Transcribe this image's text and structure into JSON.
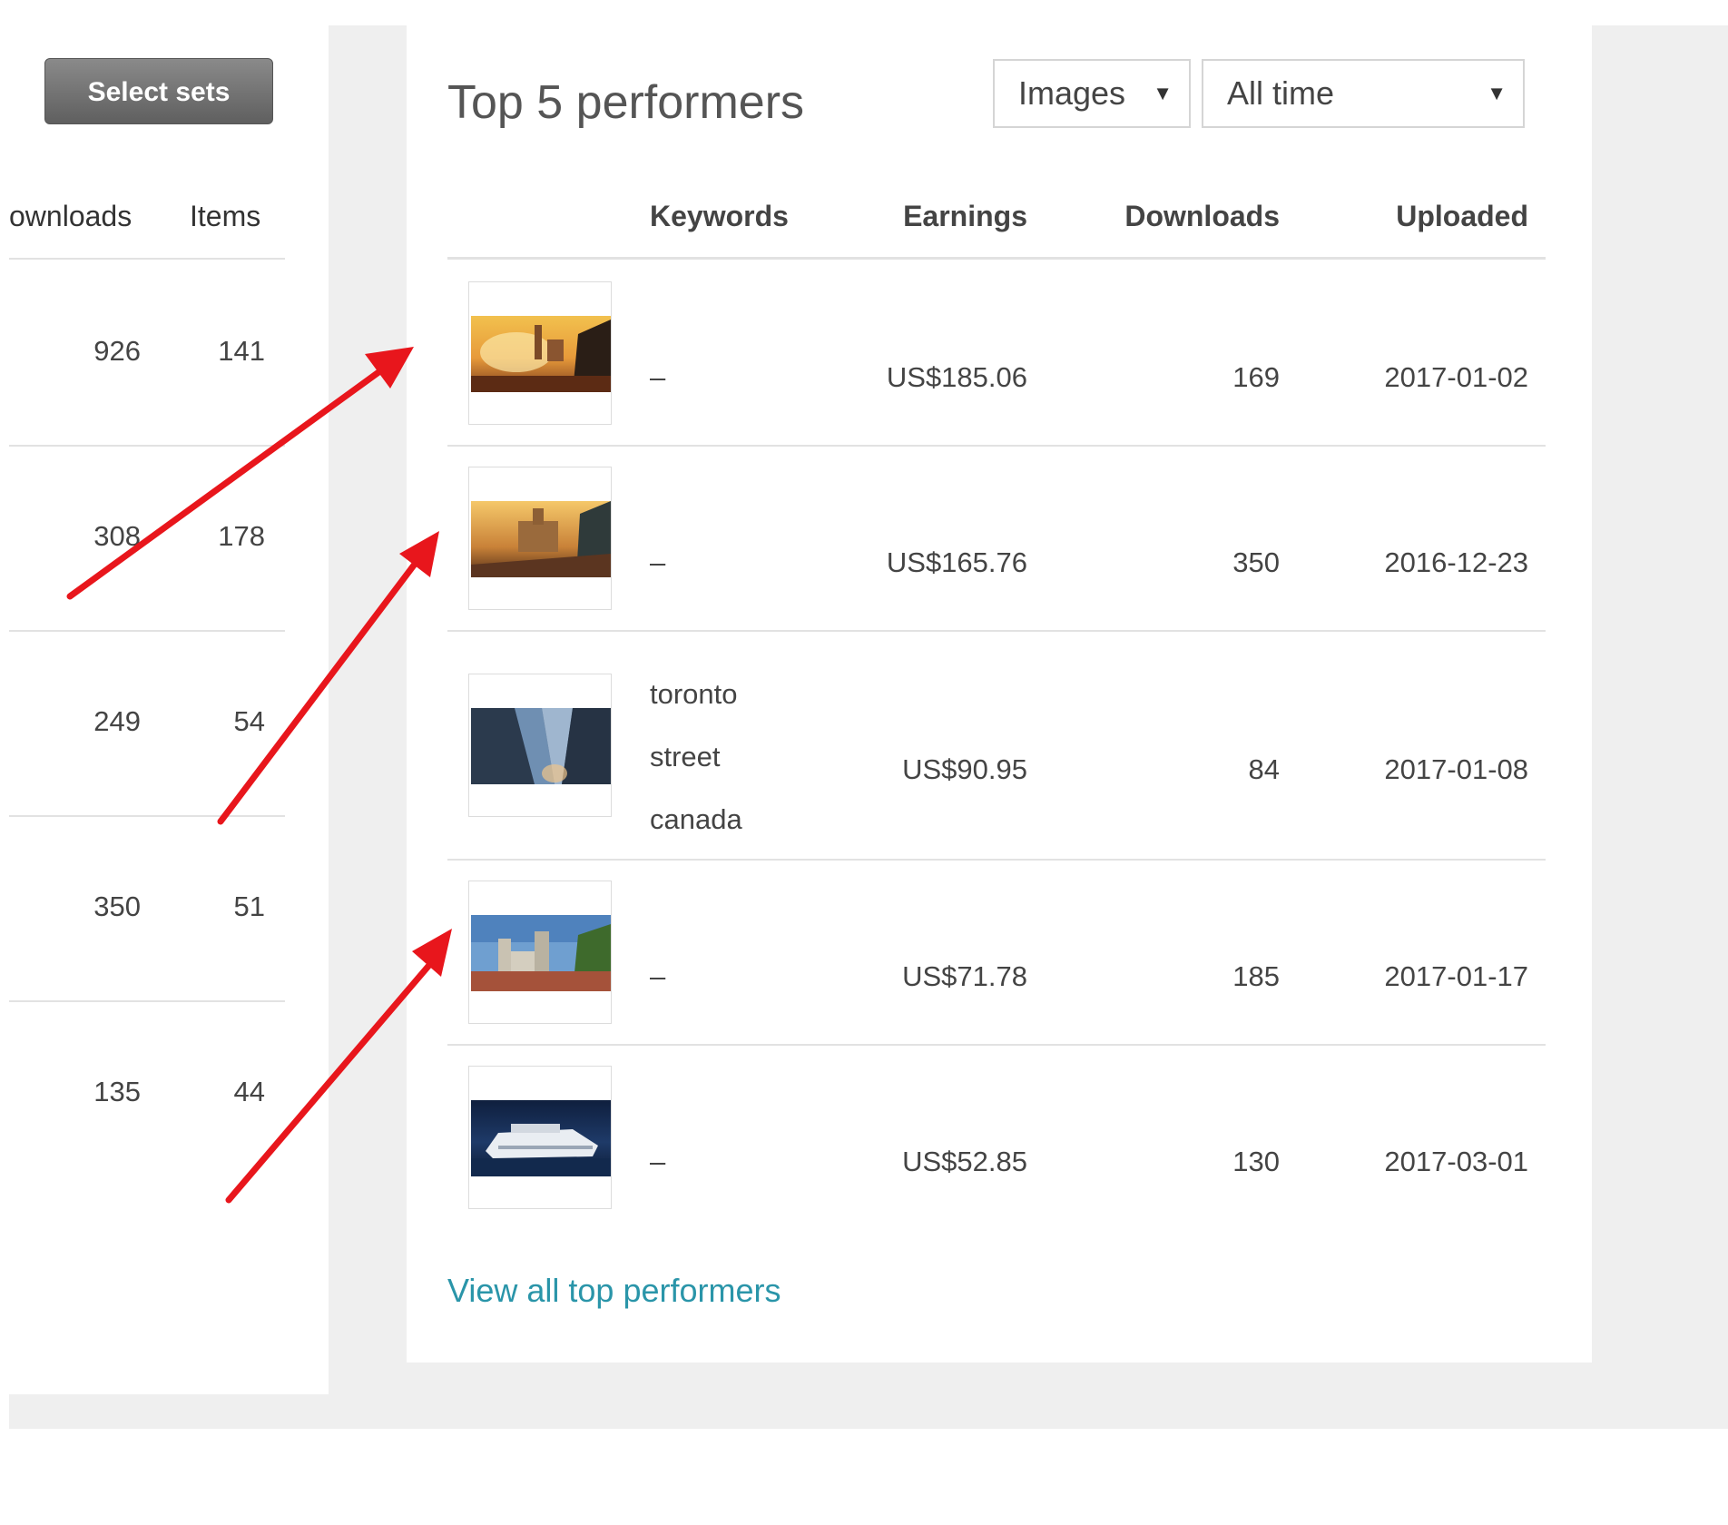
{
  "left_panel": {
    "select_sets_label": "Select sets",
    "columns": {
      "downloads": "ownloads",
      "items": "Items"
    },
    "rows": [
      {
        "downloads": "926",
        "items": "141"
      },
      {
        "downloads": "308",
        "items": "178"
      },
      {
        "downloads": "249",
        "items": "54"
      },
      {
        "downloads": "350",
        "items": "51"
      },
      {
        "downloads": "135",
        "items": "44"
      }
    ]
  },
  "top_performers": {
    "title": "Top 5 performers",
    "filters": {
      "type_value": "Images",
      "period_value": "All time"
    },
    "columns": {
      "keywords": "Keywords",
      "earnings": "Earnings",
      "downloads": "Downloads",
      "uploaded": "Uploaded"
    },
    "rows": [
      {
        "keywords": [
          "–"
        ],
        "earnings": "US$185.06",
        "downloads": "169",
        "uploaded": "2017-01-02",
        "thumbnail": "sunset-city-street-photo"
      },
      {
        "keywords": [
          "–"
        ],
        "earnings": "US$165.76",
        "downloads": "350",
        "uploaded": "2016-12-23",
        "thumbnail": "sunset-building-photo"
      },
      {
        "keywords": [
          "toronto",
          "street",
          "canada"
        ],
        "earnings": "US$90.95",
        "downloads": "84",
        "uploaded": "2017-01-08",
        "thumbnail": "skyscraper-photo"
      },
      {
        "keywords": [
          "–"
        ],
        "earnings": "US$71.78",
        "downloads": "185",
        "uploaded": "2017-01-17",
        "thumbnail": "church-towers-photo"
      },
      {
        "keywords": [
          "–"
        ],
        "earnings": "US$52.85",
        "downloads": "130",
        "uploaded": "2017-03-01",
        "thumbnail": "cruise-ship-photo"
      }
    ],
    "view_all_label": "View all top performers"
  },
  "colors": {
    "annotation_arrow": "#e8161c",
    "link": "#2a95a9",
    "backdrop": "#efefef"
  }
}
